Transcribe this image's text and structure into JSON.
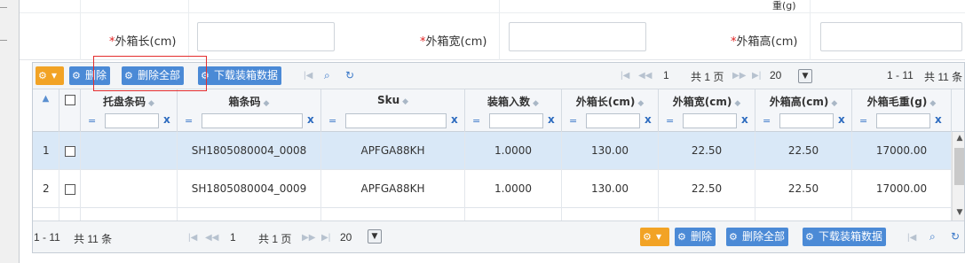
{
  "form": {
    "partial_label": "重(g)",
    "fields": [
      {
        "label": "外箱长(cm)",
        "value": ""
      },
      {
        "label": "外箱宽(cm)",
        "value": ""
      },
      {
        "label": "外箱高(cm)",
        "value": ""
      }
    ],
    "required_mark": "*"
  },
  "toolbar": {
    "gear_caret": "▾",
    "delete_label": "删除",
    "delete_all_label": "删除全部",
    "download_label": "下载装箱数据",
    "first": "|◀",
    "prev": "◀◀",
    "page_value": "1",
    "total_pages": "共 1 页",
    "next": "▶▶",
    "last": "▶|",
    "page_size": "20",
    "range": "1 - 11",
    "total": "共 11 条"
  },
  "columns": [
    {
      "title": "",
      "filter": false
    },
    {
      "title": "",
      "filter": false
    },
    {
      "title": "托盘条码",
      "filter": true
    },
    {
      "title": "箱条码",
      "filter": true
    },
    {
      "title": "Sku",
      "filter": true
    },
    {
      "title": "装箱入数",
      "filter": true
    },
    {
      "title": "外箱长(cm)",
      "filter": true
    },
    {
      "title": "外箱宽(cm)",
      "filter": true
    },
    {
      "title": "外箱高(cm)",
      "filter": true
    },
    {
      "title": "外箱毛重(g)",
      "filter": true
    }
  ],
  "filter_eq": "=",
  "filter_clear": "x",
  "rows": [
    {
      "num": "1",
      "pallet": "",
      "box": "SH1805080004_0008",
      "sku": "APFGA88KH",
      "qty": "1.0000",
      "len": "130.00",
      "wid": "22.50",
      "hei": "22.50",
      "wt": "17000.00",
      "selected": true
    },
    {
      "num": "2",
      "pallet": "",
      "box": "SH1805080004_0009",
      "sku": "APFGA88KH",
      "qty": "1.0000",
      "len": "130.00",
      "wid": "22.50",
      "hei": "22.50",
      "wt": "17000.00",
      "selected": false
    }
  ],
  "footer": {
    "range": "1 - 11",
    "total": "共 11 条",
    "page_value": "1",
    "total_pages": "共 1 页",
    "page_size": "20",
    "delete_label": "删除",
    "delete_all_label": "删除全部",
    "download_label": "下载装箱数据"
  },
  "colors": {
    "accent_blue": "#4b8ad6",
    "accent_orange": "#f2a325",
    "highlight_red": "#e42d2d",
    "selected_row": "#d9e8f7"
  }
}
